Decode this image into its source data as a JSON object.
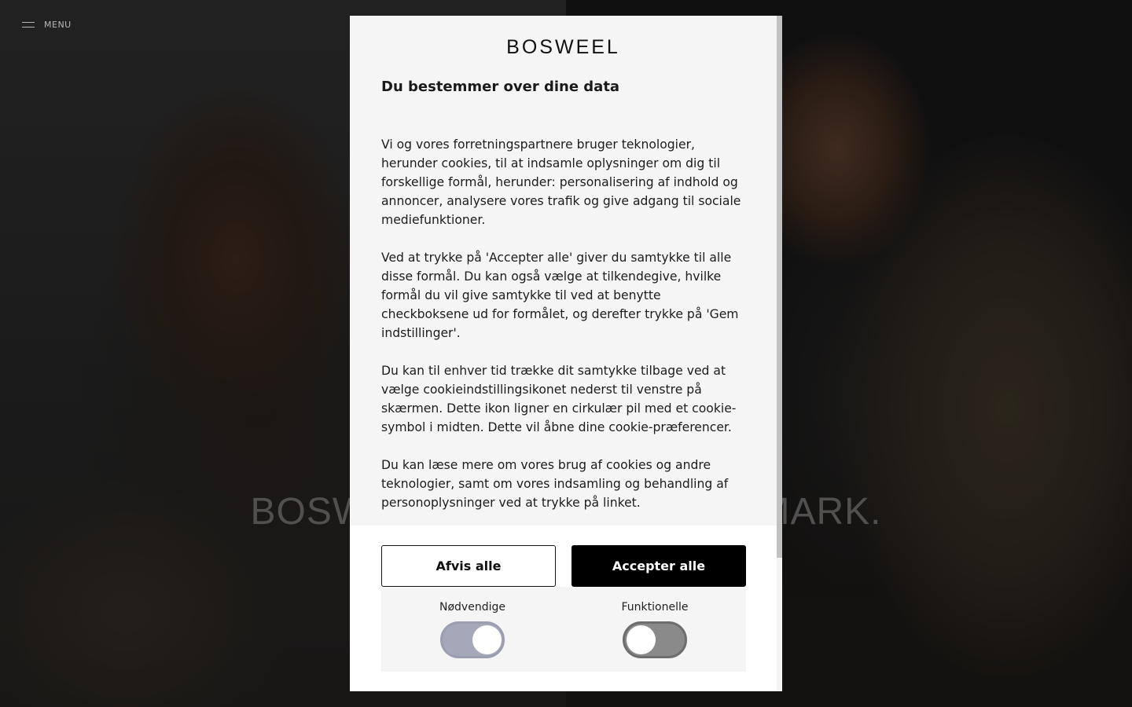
{
  "background": {
    "menu_label": "MENU",
    "hero_title": "BOSWEEL — MADE IN DENMARK."
  },
  "modal": {
    "logo": "BOSWEEL",
    "heading": "Du bestemmer over dine data",
    "paragraphs": [
      "Vi og vores forretningspartnere bruger teknologier, herunder cookies, til at indsamle oplysninger om dig til forskellige formål, herunder: personalisering af indhold og annoncer, analysere vores trafik og give adgang til sociale mediefunktioner.",
      "Ved at trykke på 'Accepter alle' giver du samtykke til alle disse formål. Du kan også vælge at tilkendegive, hvilke formål du vil give samtykke til ved at benytte checkboksene ud for formålet, og derefter trykke på 'Gem indstillinger'.",
      "Du kan til enhver tid trække dit samtykke tilbage ved at vælge cookieindstillingsikonet nederst til venstre på skærmen. Dette ikon ligner en cirkulær pil med et cookie-symbol i midten. Dette vil åbne dine cookie-præferencer.",
      "Du kan læse mere om vores brug af cookies og andre teknologier, samt om vores indsamling og behandling af personoplysninger ved at trykke på linket."
    ],
    "reject_label": "Afvis alle",
    "accept_label": "Accepter alle",
    "toggles": [
      {
        "label": "Nødvendige",
        "on": true
      },
      {
        "label": "Funktionelle",
        "on": false
      }
    ]
  }
}
